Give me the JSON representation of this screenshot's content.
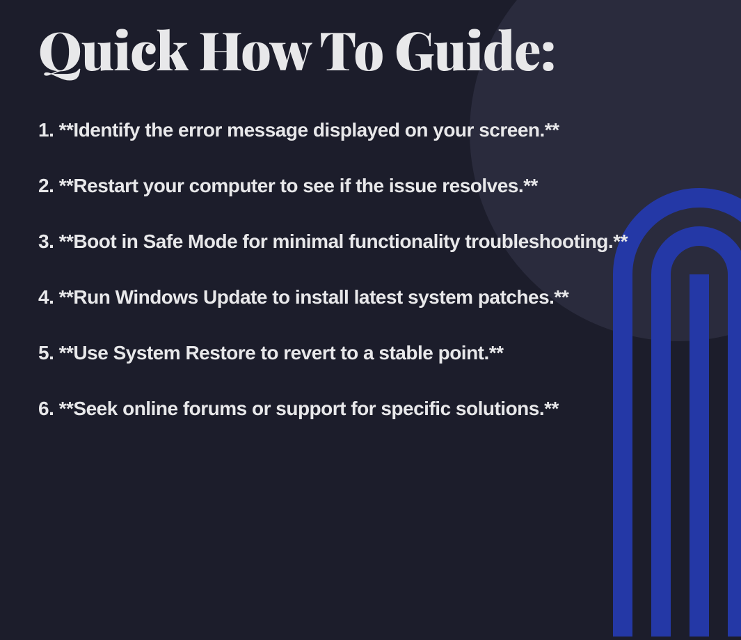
{
  "title": "Quick How To Guide:",
  "steps": [
    "1. **Identify the error message displayed on your screen.**",
    "2. **Restart your computer to see if the issue resolves.**",
    "3. **Boot in Safe Mode for minimal functionality troubleshooting.**",
    "4. **Run Windows Update to install latest system patches.**",
    "5. **Use System Restore to revert to a stable point.**",
    "6. **Seek online forums or support for specific solutions.**"
  ],
  "colors": {
    "background": "#1c1d2b",
    "circle": "#2a2b3d",
    "arch": "#2438a6",
    "text": "#e8e8ea"
  }
}
